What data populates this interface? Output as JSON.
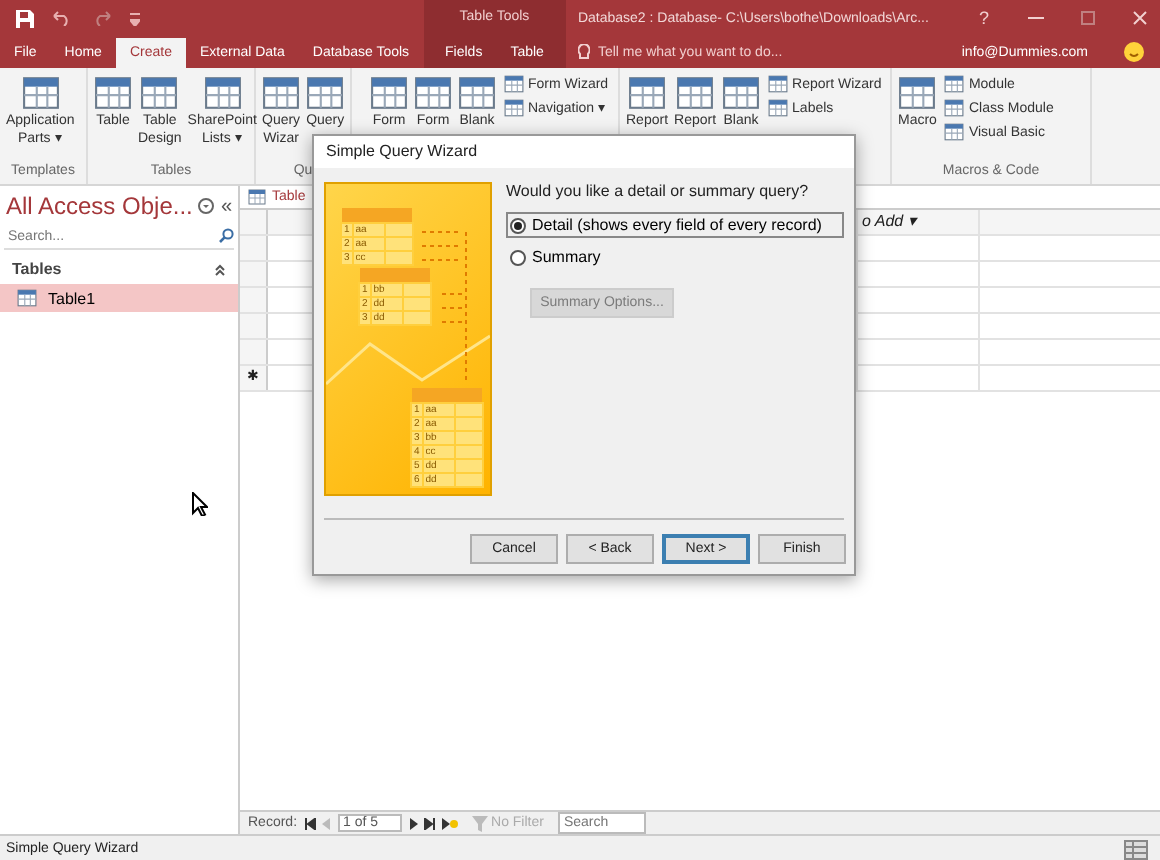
{
  "title_bar": {
    "title": "Database2 : Database- C:\\Users\\bothe\\Downloads\\Arc...",
    "help": "?"
  },
  "tabs": [
    {
      "label": "File",
      "selected": false
    },
    {
      "label": "Home",
      "selected": false
    },
    {
      "label": "Create",
      "selected": true
    },
    {
      "label": "External Data",
      "selected": false
    },
    {
      "label": "Database Tools",
      "selected": false
    }
  ],
  "context_tabs": {
    "label": "Table Tools",
    "tabs": [
      {
        "label": "Fields",
        "selected": false
      },
      {
        "label": "Table",
        "selected": false
      }
    ]
  },
  "tell_me": {
    "placeholder": "Tell me what you want to do..."
  },
  "account": "info@Dummies.com",
  "ribbon": {
    "groups": [
      {
        "label": "Templates",
        "items": [
          {
            "kind": "large",
            "lines": [
              "Application",
              "Parts ▾"
            ]
          }
        ]
      },
      {
        "label": "Tables",
        "items": [
          {
            "kind": "large",
            "lines": [
              "Table"
            ]
          },
          {
            "kind": "large",
            "lines": [
              "Table",
              "Design"
            ]
          },
          {
            "kind": "large",
            "lines": [
              "SharePoint",
              "Lists ▾"
            ]
          }
        ]
      },
      {
        "label": "Qu",
        "items": [
          {
            "kind": "large",
            "lines": [
              "Query",
              "Wizar"
            ]
          },
          {
            "kind": "large",
            "lines": [
              "Query"
            ]
          }
        ]
      },
      {
        "items": [
          {
            "kind": "large",
            "lines": [
              "Form"
            ]
          },
          {
            "kind": "large",
            "lines": [
              "Form"
            ]
          },
          {
            "kind": "large",
            "lines": [
              "Blank"
            ]
          },
          {
            "kind": "small",
            "label": "Form Wizard"
          },
          {
            "kind": "small",
            "label": "Navigation ▾"
          }
        ]
      },
      {
        "items": [
          {
            "kind": "large",
            "lines": [
              "Report"
            ]
          },
          {
            "kind": "large",
            "lines": [
              "Report"
            ]
          },
          {
            "kind": "large",
            "lines": [
              "Blank"
            ]
          },
          {
            "kind": "small",
            "label": "Report Wizard"
          },
          {
            "kind": "small",
            "label": "Labels"
          }
        ]
      },
      {
        "label": "Macros & Code",
        "items": [
          {
            "kind": "large",
            "lines": [
              "Macro"
            ]
          },
          {
            "kind": "small",
            "label": "Module"
          },
          {
            "kind": "small",
            "label": "Class Module"
          },
          {
            "kind": "small",
            "label": "Visual Basic"
          }
        ]
      }
    ]
  },
  "nav_pane": {
    "title": "All Access Obje...",
    "collapse": "«",
    "search": {
      "placeholder": "Search..."
    },
    "sections": [
      {
        "label": "Tables",
        "items": [
          {
            "label": "Table1",
            "selected": true
          }
        ]
      }
    ]
  },
  "datasheet": {
    "tab": "Table",
    "column_header": "o Add ▾",
    "new_record_marker": "✱",
    "record_bar": {
      "label": "Record:",
      "position": "1 of 5",
      "filter": "No Filter",
      "search": {
        "placeholder": "Search"
      }
    }
  },
  "status_bar": {
    "text": "Simple Query Wizard"
  },
  "dialog": {
    "title": "Simple Query Wizard",
    "question": "Would you like a detail or summary query?",
    "options": [
      {
        "label": "Detail (shows every field of every record)",
        "selected": true
      },
      {
        "label": "Summary",
        "selected": false
      }
    ],
    "summary_button": {
      "label": "Summary Options...",
      "disabled": true
    },
    "illustration": {
      "tables": [
        [
          [
            "1",
            "aa"
          ],
          [
            "2",
            "aa"
          ],
          [
            "3",
            "cc"
          ]
        ],
        [
          [
            "1",
            "bb"
          ],
          [
            "2",
            "dd"
          ],
          [
            "3",
            "dd"
          ]
        ],
        [
          [
            "1",
            "aa"
          ],
          [
            "2",
            "aa"
          ],
          [
            "3",
            "bb"
          ],
          [
            "4",
            "cc"
          ],
          [
            "5",
            "dd"
          ],
          [
            "6",
            "dd"
          ]
        ]
      ]
    },
    "buttons": [
      {
        "label": "Cancel",
        "default": false
      },
      {
        "label": "< Back",
        "default": false
      },
      {
        "label": "Next >",
        "default": true
      },
      {
        "label": "Finish",
        "default": false
      }
    ]
  }
}
